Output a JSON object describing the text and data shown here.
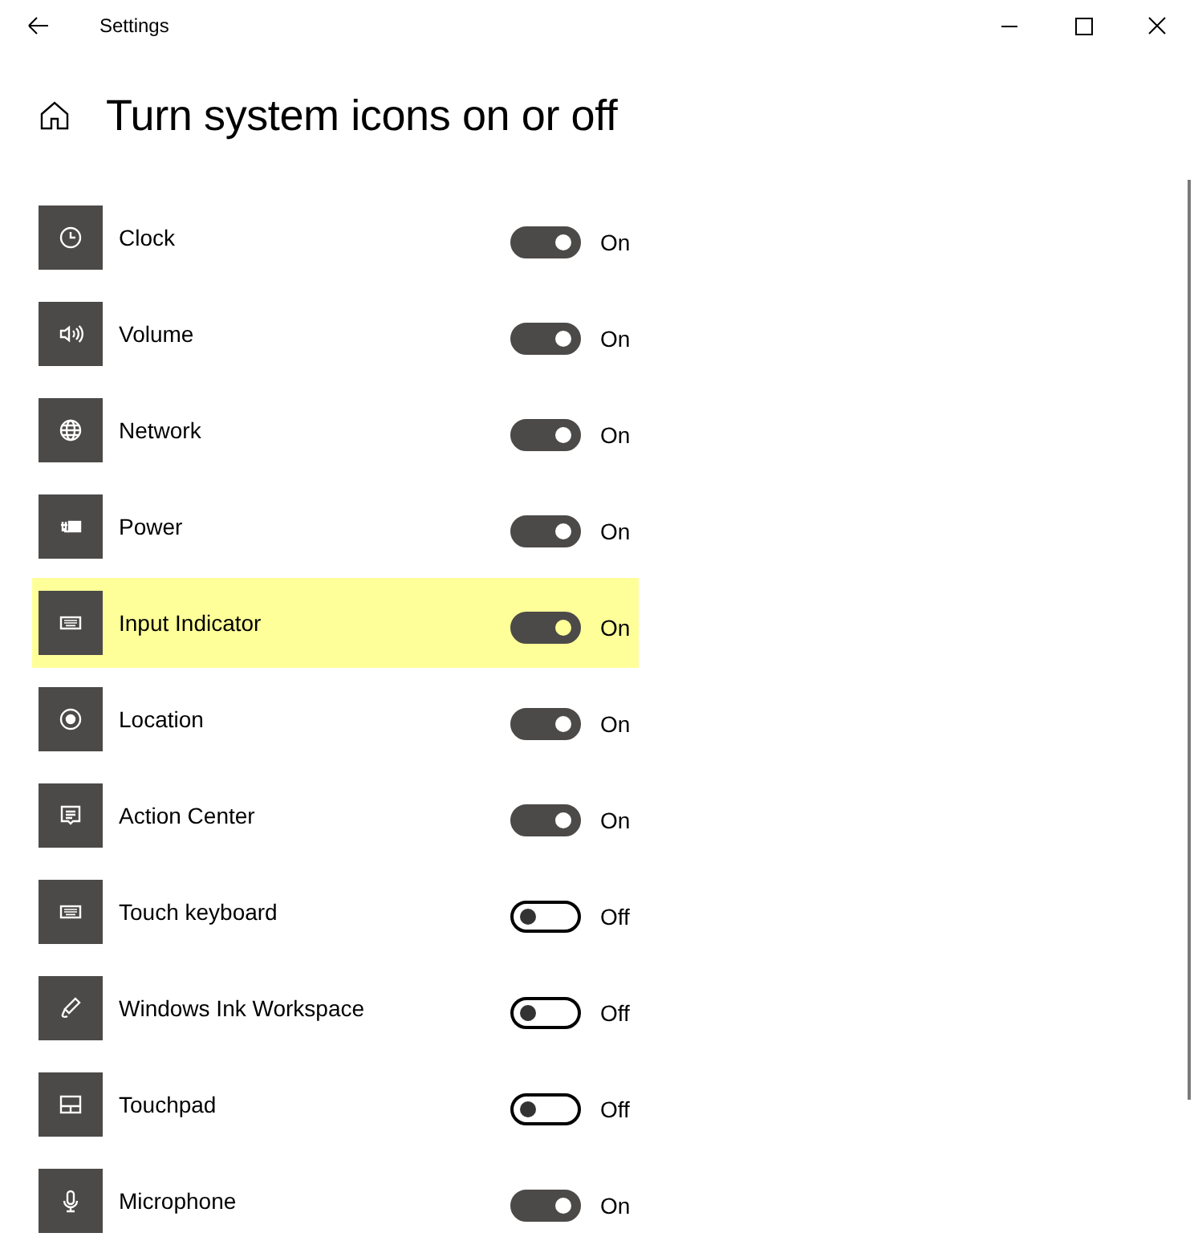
{
  "window": {
    "title": "Settings"
  },
  "page_title": "Turn system icons on or off",
  "items": [
    {
      "label": "Clock",
      "on": true,
      "state": "On",
      "highlighted": false
    },
    {
      "label": "Volume",
      "on": true,
      "state": "On",
      "highlighted": false
    },
    {
      "label": "Network",
      "on": true,
      "state": "On",
      "highlighted": false
    },
    {
      "label": "Power",
      "on": true,
      "state": "On",
      "highlighted": false
    },
    {
      "label": "Input Indicator",
      "on": true,
      "state": "On",
      "highlighted": true
    },
    {
      "label": "Location",
      "on": true,
      "state": "On",
      "highlighted": false
    },
    {
      "label": "Action Center",
      "on": true,
      "state": "On",
      "highlighted": false
    },
    {
      "label": "Touch keyboard",
      "on": false,
      "state": "Off",
      "highlighted": false
    },
    {
      "label": "Windows Ink Workspace",
      "on": false,
      "state": "Off",
      "highlighted": false
    },
    {
      "label": "Touchpad",
      "on": false,
      "state": "Off",
      "highlighted": false
    },
    {
      "label": "Microphone",
      "on": true,
      "state": "On",
      "highlighted": false
    }
  ]
}
